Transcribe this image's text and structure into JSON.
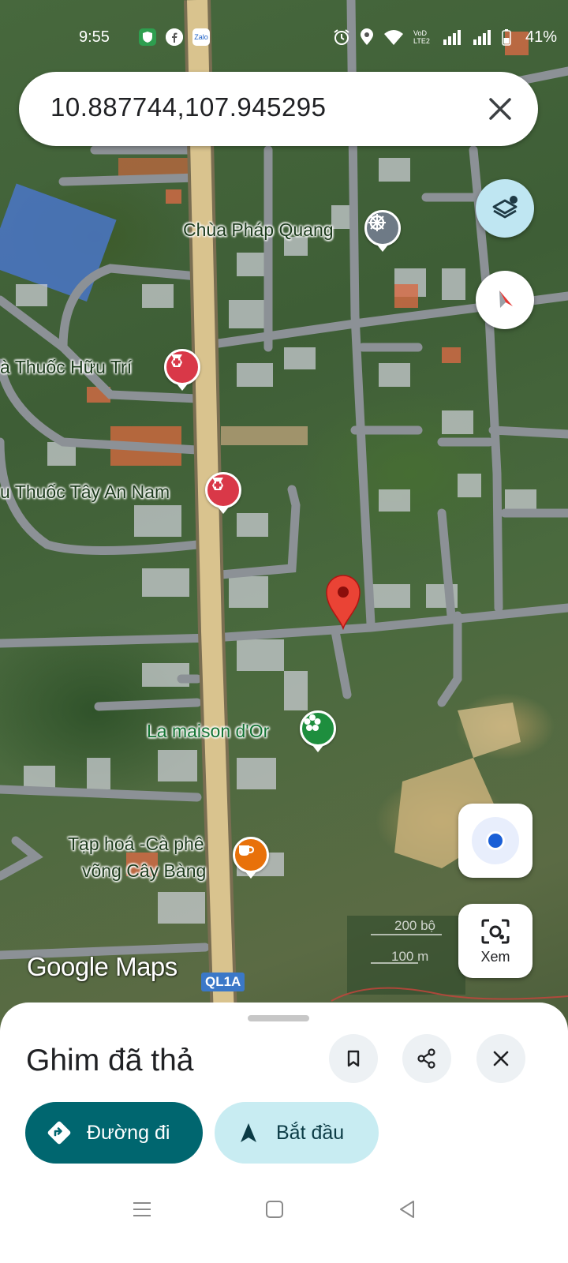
{
  "status_bar": {
    "time": "9:55",
    "notifications": [
      "shield-icon",
      "facebook-icon",
      "zalo-icon"
    ],
    "zalo_text": "Zalo",
    "network_label": "VoD LTE2",
    "battery": "41%"
  },
  "search": {
    "query": "10.887744,107.945295"
  },
  "map": {
    "pois": [
      {
        "name": "Chùa Pháp Quang",
        "icon": "temple-icon",
        "color": "#6e7a86"
      },
      {
        "name": "à Thuốc Hữu Trí",
        "icon": "pharmacy-icon",
        "color": "#d93848"
      },
      {
        "name": "u Thuốc Tây An Nam",
        "icon": "pharmacy-icon",
        "color": "#d93848"
      },
      {
        "name": "La maison d'Or",
        "icon": "flower-icon",
        "color": "#1e8e3e"
      },
      {
        "name_line1": "Tạp hoá -Cà phê",
        "name_line2": "võng Cây Bàng",
        "icon": "cafe-icon",
        "color": "#e8710a"
      }
    ],
    "road_shield": "QL1A",
    "scale_ft": "200 bộ",
    "scale_m": "100 m",
    "logo": "Google Maps",
    "dropped_pin_color": "#ea4335"
  },
  "controls": {
    "layers": "layers-icon",
    "compass": "compass-icon",
    "my_location": "my-location-icon",
    "xem_label": "Xem"
  },
  "sheet": {
    "title": "Ghim đã thả",
    "directions_label": "Đường đi",
    "start_label": "Bắt đầu",
    "accent": "#00666f"
  }
}
